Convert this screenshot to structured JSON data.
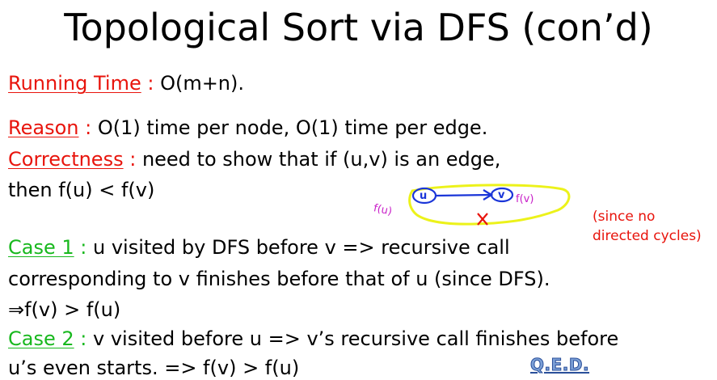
{
  "slide": {
    "title": "Topological Sort via DFS (con’d)",
    "running_time": {
      "label": "Running Time",
      "sep": " : ",
      "text": "O(m+n)."
    },
    "reason": {
      "label": "Reason",
      "sep": " : ",
      "text": "O(1) time per node, O(1) time per edge."
    },
    "correctness": {
      "label": "Correctness",
      "sep": " : ",
      "text": "need to show that if (u,v) is an edge,",
      "text2": "then f(u) < f(v)"
    },
    "note": {
      "line1": "(since no",
      "line2": "directed cycles)"
    },
    "case1": {
      "label": "Case 1",
      "sep": " : ",
      "text": "u visited by DFS before v => recursive call",
      "text2": "corresponding to v finishes before that of u (since DFS).",
      "text3": "⇒f(v) >  f(u)"
    },
    "case2": {
      "label": "Case 2",
      "sep": " : ",
      "text": "v visited before u => v’s recursive call finishes before",
      "text2": "u’s even starts. => f(v) > f(u)"
    },
    "qed": "Q.E.D.",
    "sketch": {
      "fu": "f(u)",
      "u": "u",
      "v": "v",
      "fv": "f(v)"
    }
  },
  "colors": {
    "red": "#e8140c",
    "green": "#18b81e",
    "blue_ink": "#1a35d8",
    "highlighter": "#ecf21a",
    "qed_fill": "#7b9fd6",
    "qed_stroke": "#2a4f9a"
  }
}
